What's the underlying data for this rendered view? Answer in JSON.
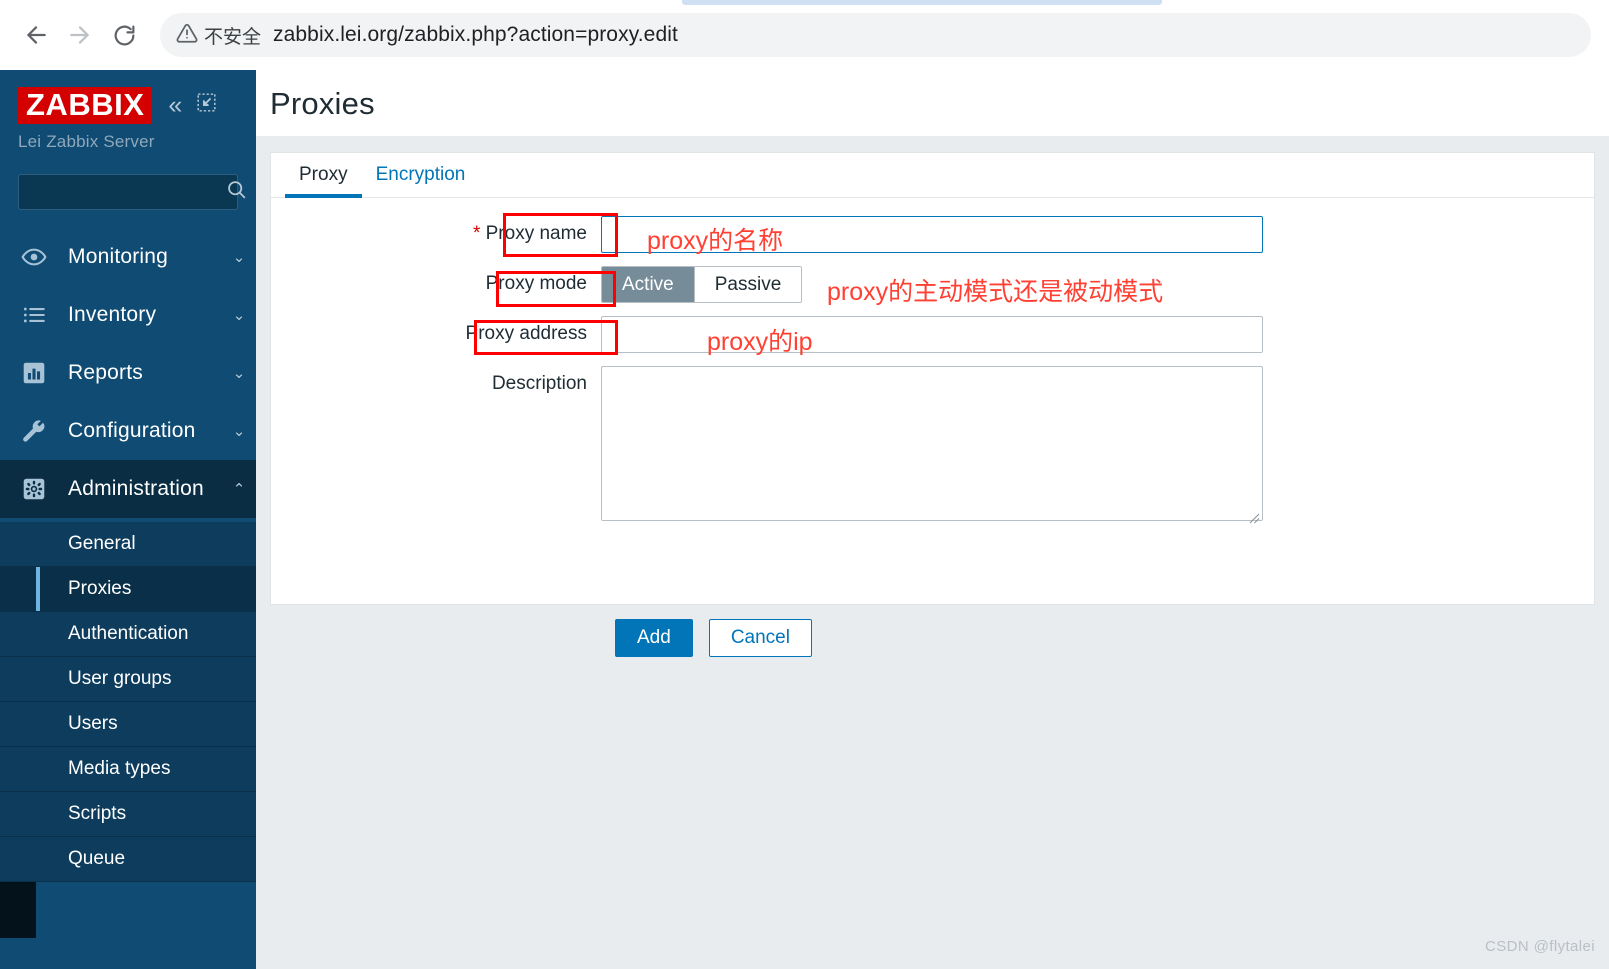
{
  "browser": {
    "back_icon": "arrow-left-icon",
    "forward_icon": "arrow-right-icon",
    "reload_icon": "reload-icon",
    "security_icon": "warning-triangle-icon",
    "security_label": "不安全",
    "url": "zabbix.lei.org/zabbix.php?action=proxy.edit"
  },
  "sidebar": {
    "logo": "ZABBIX",
    "server_name": "Lei Zabbix Server",
    "collapse_icon": "double-chevron-left-icon",
    "kiosk_icon": "kiosk-expand-icon",
    "search": {
      "value": "",
      "placeholder": "",
      "icon": "search-icon"
    },
    "nav": [
      {
        "label": "Monitoring",
        "icon": "eye-icon",
        "chevron": "⌄",
        "active": false
      },
      {
        "label": "Inventory",
        "icon": "list-icon",
        "chevron": "⌄",
        "active": false
      },
      {
        "label": "Reports",
        "icon": "barchart-icon",
        "chevron": "⌄",
        "active": false
      },
      {
        "label": "Configuration",
        "icon": "wrench-icon",
        "chevron": "⌄",
        "active": false
      },
      {
        "label": "Administration",
        "icon": "gear-icon",
        "chevron": "⌃",
        "active": true
      }
    ],
    "submenu": [
      {
        "label": "General",
        "active": false
      },
      {
        "label": "Proxies",
        "active": true
      },
      {
        "label": "Authentication",
        "active": false
      },
      {
        "label": "User groups",
        "active": false
      },
      {
        "label": "Users",
        "active": false
      },
      {
        "label": "Media types",
        "active": false
      },
      {
        "label": "Scripts",
        "active": false
      },
      {
        "label": "Queue",
        "active": false
      }
    ]
  },
  "page": {
    "title": "Proxies",
    "tabs": [
      {
        "label": "Proxy",
        "active": true
      },
      {
        "label": "Encryption",
        "active": false
      }
    ]
  },
  "form": {
    "proxy_name": {
      "label": "Proxy name",
      "required_marker": "*",
      "value": "",
      "placeholder": ""
    },
    "proxy_mode": {
      "label": "Proxy mode",
      "options": [
        "Active",
        "Passive"
      ],
      "selected": "Active"
    },
    "proxy_address": {
      "label": "Proxy address",
      "value": "",
      "placeholder": ""
    },
    "description": {
      "label": "Description",
      "value": "",
      "placeholder": ""
    },
    "buttons": {
      "add": "Add",
      "cancel": "Cancel"
    }
  },
  "annotations": {
    "color": "#ff4033",
    "box_color": "#ff0000",
    "proxy_name_note": "proxy的名称",
    "proxy_mode_note": "proxy的主动模式还是被动模式",
    "proxy_address_note": "proxy的ip"
  },
  "watermark": "CSDN @flytalei"
}
